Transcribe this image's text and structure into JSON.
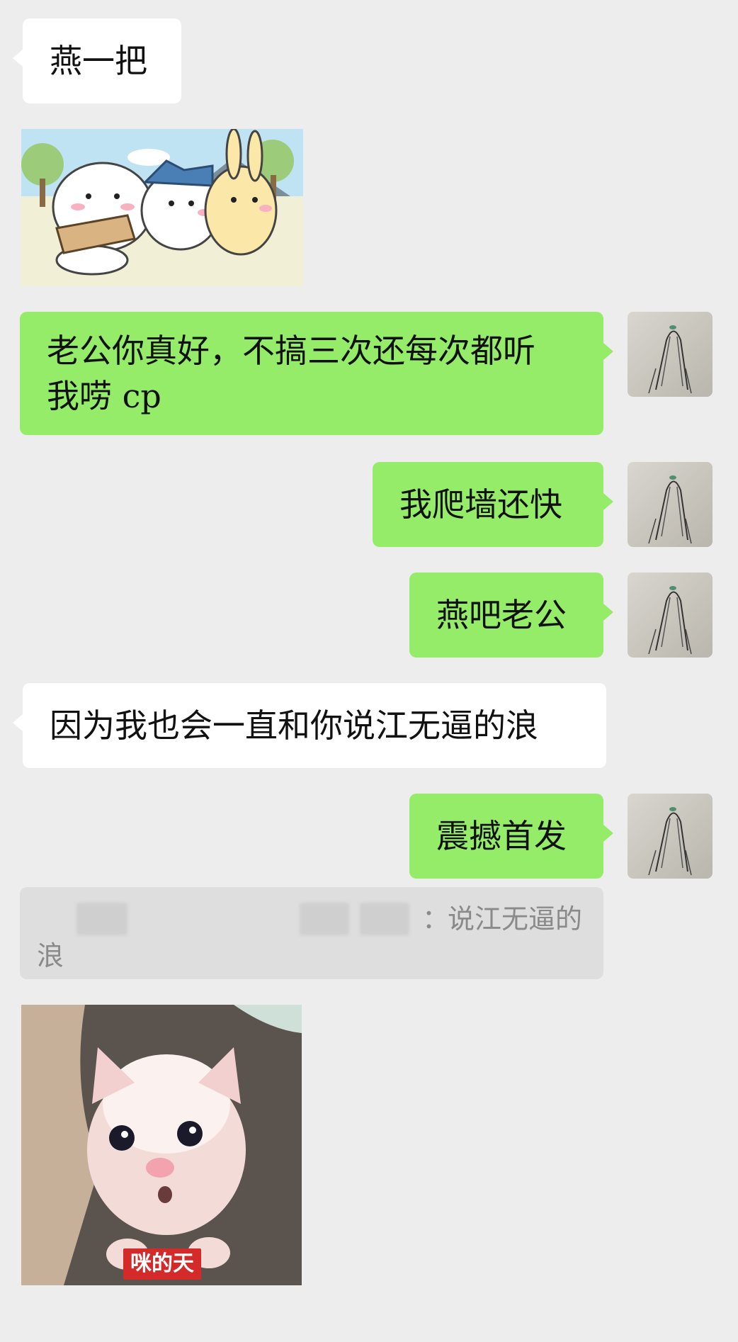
{
  "messages": {
    "m1": "燕一把",
    "m3": "老公你真好，不搞三次还每次都听\n我唠 cp",
    "m4": "我爬墙还快",
    "m5": "燕吧老公",
    "m6": "因为我也会一直和你说江无逼的浪",
    "m7": "震撼首发"
  },
  "quote": {
    "separator": "：",
    "text_tail": "说江无逼的",
    "text_line2": "浪"
  },
  "sticker2": {
    "caption": "咪的天"
  },
  "colors": {
    "background": "#ededed",
    "bubble_self": "#95ec69",
    "bubble_other": "#ffffff"
  },
  "icons": {
    "avatar": "praying-hands-sketch-avatar"
  }
}
